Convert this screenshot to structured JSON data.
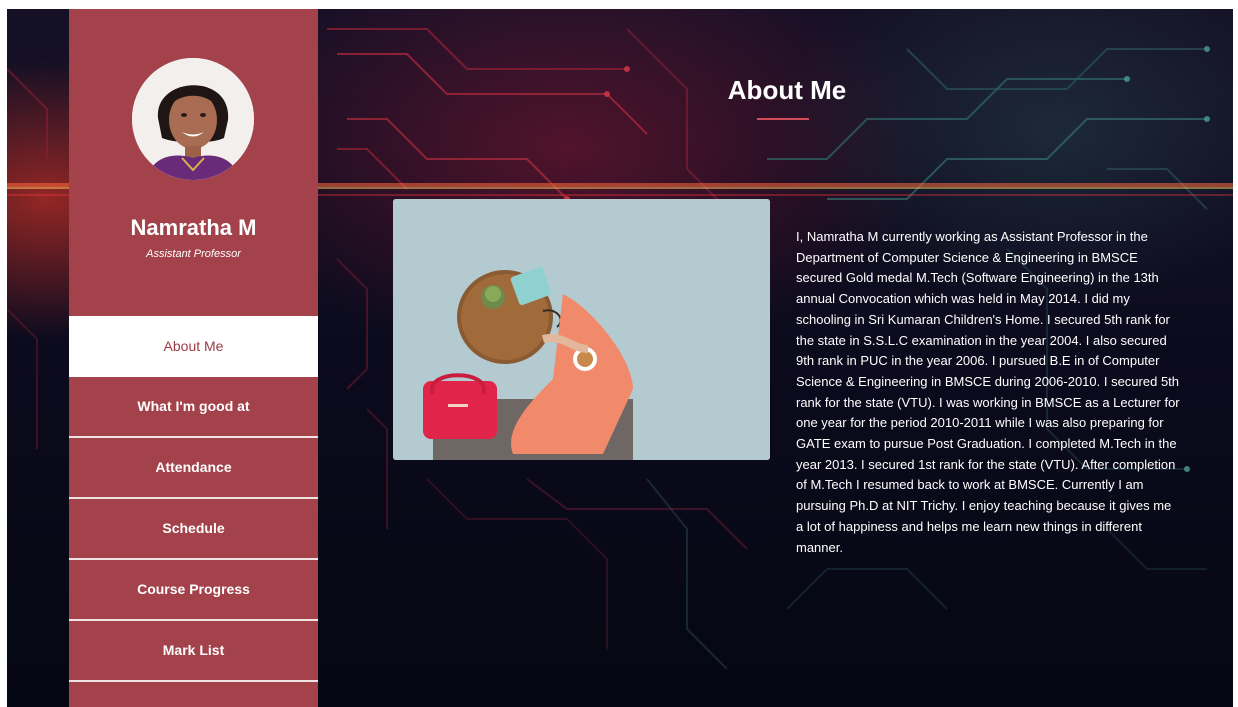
{
  "profile": {
    "name": "Namratha M",
    "role": "Assistant Professor"
  },
  "nav": {
    "items": [
      {
        "label": "About Me",
        "active": true
      },
      {
        "label": "What I'm good at",
        "active": false
      },
      {
        "label": "Attendance",
        "active": false
      },
      {
        "label": "Schedule",
        "active": false
      },
      {
        "label": "Course Progress",
        "active": false
      },
      {
        "label": "Mark List",
        "active": false
      }
    ]
  },
  "main": {
    "title": "About Me",
    "about_text": "I, Namratha M currently working as Assistant Professor in the Department of Computer Science & Engineering in BMSCE secured Gold medal M.Tech (Software Engineering) in the 13th annual Convocation which was held in May 2014. I did my schooling in Sri Kumaran Children's Home. I secured 5th rank for the state in S.S.L.C examination in the year 2004. I also secured 9th rank in PUC in the year 2006. I pursued B.E in of Computer Science & Engineering in BMSCE during 2006-2010. I secured 5th rank for the state (VTU). I was working in BMSCE as a Lecturer for one year for the period 2010-2011 while I was also preparing for GATE exam to pursue Post Graduation. I completed M.Tech in the year 2013. I secured 1st rank for the state (VTU). After completion of M.Tech I resumed back to work at BMSCE. Currently I am pursuing Ph.D at NIT Trichy. I enjoy teaching because it gives me a lot of happiness and helps me learn new things in different manner."
  },
  "colors": {
    "sidebar": "#a3424b",
    "active_text": "#9b3b44",
    "accent_underline": "#d24c57",
    "background": "#0b0a1c"
  }
}
